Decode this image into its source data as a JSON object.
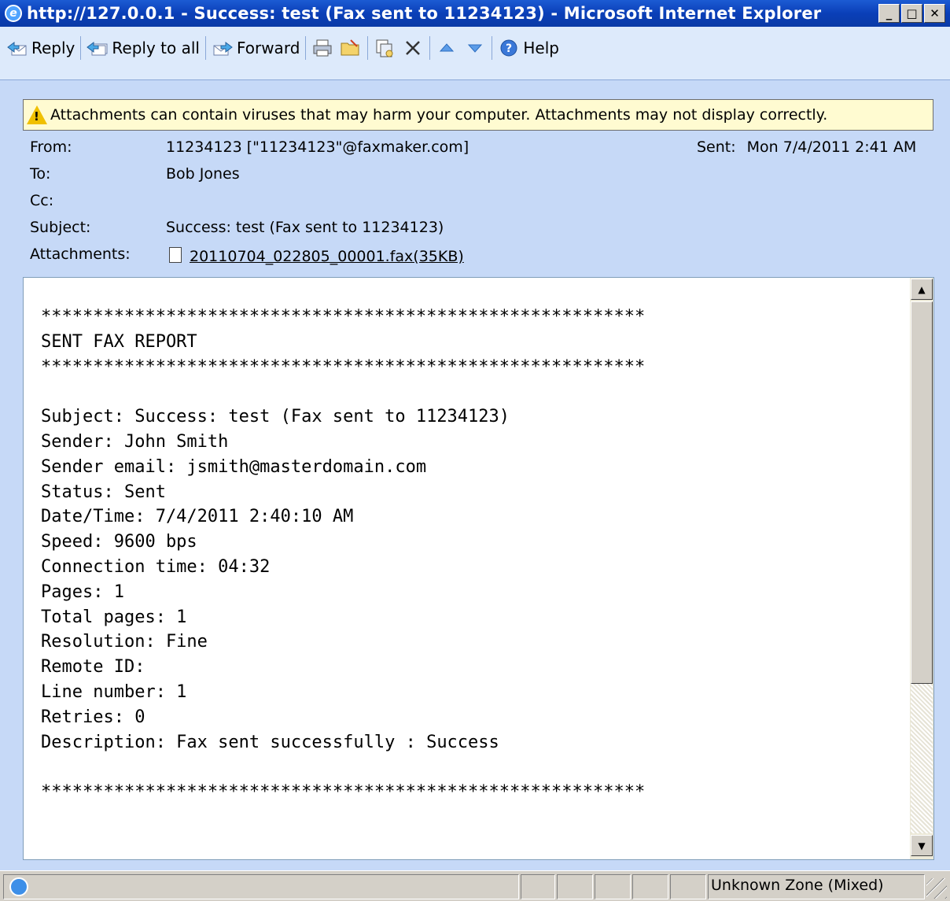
{
  "window": {
    "title": "http://127.0.0.1 - Success: test (Fax sent to 11234123) - Microsoft Internet Explorer"
  },
  "toolbar": {
    "reply_label": "Reply",
    "reply_all_label": "Reply to all",
    "forward_label": "Forward",
    "help_label": "Help"
  },
  "warning": {
    "text": "Attachments can contain viruses that may harm your computer. Attachments may not display correctly."
  },
  "headers": {
    "from_label": "From:",
    "from_value": "11234123 [\"11234123\"@faxmaker.com]",
    "sent_label": "Sent:",
    "sent_value": "Mon 7/4/2011 2:41 AM",
    "to_label": "To:",
    "to_value": "Bob Jones",
    "cc_label": "Cc:",
    "subject_label": "Subject:",
    "subject_value": "Success: test (Fax sent to 11234123)",
    "attachments_label": "Attachments:",
    "attachment_name": "20110704_022805_00001.fax(35KB)"
  },
  "body": {
    "lines": [
      "**********************************************************",
      "SENT FAX REPORT",
      "**********************************************************",
      "",
      "Subject: Success: test (Fax sent to 11234123)",
      "Sender: John Smith",
      "Sender email: jsmith@masterdomain.com",
      "Status: Sent",
      "Date/Time: 7/4/2011 2:40:10 AM",
      "Speed: 9600 bps",
      "Connection time: 04:32",
      "Pages: 1",
      "Total pages: 1",
      "Resolution: Fine",
      "Remote ID:",
      "Line number: 1",
      "Retries: 0",
      "Description: Fax sent successfully : Success",
      "",
      "**********************************************************"
    ]
  },
  "statusbar": {
    "zone": "Unknown Zone (Mixed)"
  }
}
